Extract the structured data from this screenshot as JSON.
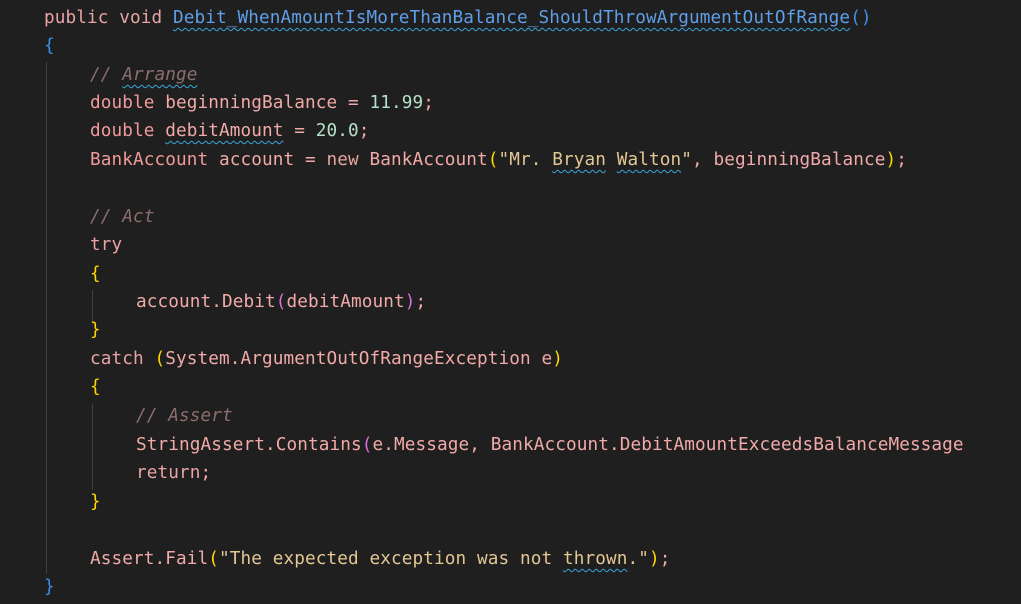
{
  "code": {
    "l1": {
      "kw1": "public",
      "kw2": "void",
      "name": "Debit_WhenAmountIsMoreThanBalance_ShouldThrowArgumentOutOfRange",
      "parens": "()"
    },
    "l2": {
      "brace": "{"
    },
    "l3": {
      "comment_slashes": "// ",
      "comment_word": "Arrange"
    },
    "l4": {
      "type": "double",
      "var": "beginningBalance",
      "eq": " = ",
      "num": "11.99",
      "end": ";"
    },
    "l5": {
      "type": "double",
      "var": "debitAmount",
      "eq": " = ",
      "num": "20.0",
      "end": ";"
    },
    "l6": {
      "type": "BankAccount",
      "var": "account",
      "eq": " = ",
      "new": "new",
      "ctor": "BankAccount",
      "open": "(",
      "str_a": "\"Mr. ",
      "str_b": "Bryan",
      "str_c": " ",
      "str_d": "Walton",
      "str_e": "\"",
      "rest": ", beginningBalance",
      "close": ")",
      "end": ";"
    },
    "l7": {
      "comment": "// Act"
    },
    "l8": {
      "kw": "try"
    },
    "l9": {
      "brace": "{"
    },
    "l10": {
      "obj": "account",
      "dot": ".",
      "method": "Debit",
      "open": "(",
      "arg": "debitAmount",
      "close": ")",
      "end": ";"
    },
    "l11": {
      "brace": "}"
    },
    "l12": {
      "kw": "catch",
      "open": "(",
      "type": "System.ArgumentOutOfRangeException e",
      "close": ")"
    },
    "l13": {
      "brace": "{"
    },
    "l14": {
      "comment": "// Assert"
    },
    "l15": {
      "obj": "StringAssert",
      "dot": ".",
      "method": "Contains",
      "open": "(",
      "args": "e.Message, BankAccount.DebitAmountExceedsBalanceMessage"
    },
    "l16": {
      "kw": "return",
      "end": ";"
    },
    "l17": {
      "brace": "}"
    },
    "l18": {
      "obj": "Assert",
      "dot": ".",
      "method": "Fail",
      "open": "(",
      "str_a": "\"The expected exception was not ",
      "str_b": "thrown",
      "str_c": ".\"",
      "close": ")",
      "end": ";"
    },
    "l19": {
      "brace": "}"
    }
  },
  "colors": {
    "background": "#1f1f1f",
    "keyword": "#e8a3a3",
    "string": "#e3c793",
    "number": "#b5e0c8",
    "comment": "#8c6d6d",
    "method_name": "#5f9fe8",
    "brace_outer": "#3b8fe6",
    "brace_inner": "#ffd700",
    "paren": "#da70d6"
  }
}
